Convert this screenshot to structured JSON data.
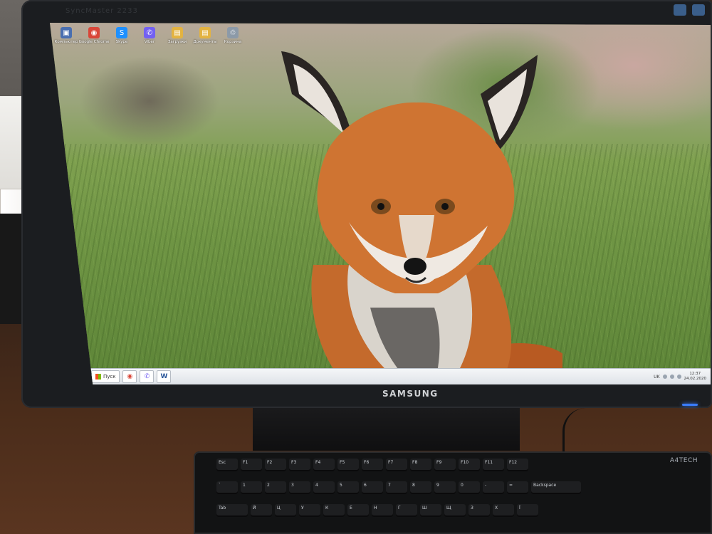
{
  "monitor": {
    "brand": "SAMSUNG",
    "top_brand": "SyncMaster 2233"
  },
  "desktop": {
    "icons": [
      {
        "label": "Компьютер",
        "icon": "computer-icon",
        "color": "#4a6fb0"
      },
      {
        "label": "Google Chrome",
        "icon": "chrome-icon",
        "color": "#d94638"
      },
      {
        "label": "Skype",
        "icon": "skype-icon",
        "color": "#1e90ff"
      },
      {
        "label": "Viber",
        "icon": "viber-icon",
        "color": "#7360f2"
      },
      {
        "label": "Загрузки",
        "icon": "folder-icon",
        "color": "#e3b341"
      },
      {
        "label": "Документы",
        "icon": "folder-icon",
        "color": "#e3b341"
      },
      {
        "label": "Корзина",
        "icon": "recycle-bin-icon",
        "color": "#8c9aa8"
      }
    ]
  },
  "taskbar": {
    "start_label": "Пуск",
    "pinned": [
      {
        "icon": "chrome-icon",
        "glyph": "◉",
        "color": "#d94638"
      },
      {
        "icon": "viber-icon",
        "glyph": "✆",
        "color": "#7360f2"
      },
      {
        "icon": "word-icon",
        "glyph": "W",
        "color": "#2b579a"
      }
    ],
    "tray_lang": "UK",
    "clock_time": "12:37",
    "clock_date": "24.02.2020"
  },
  "keyboard": {
    "brand": "A4TECH",
    "row1": [
      "Esc",
      "F1",
      "F2",
      "F3",
      "F4",
      "F5",
      "F6",
      "F7",
      "F8",
      "F9",
      "F10",
      "F11",
      "F12"
    ],
    "row2": [
      "`",
      "1",
      "2",
      "3",
      "4",
      "5",
      "6",
      "7",
      "8",
      "9",
      "0",
      "-",
      "=",
      "Backspace"
    ],
    "row3": [
      "Tab",
      "Й",
      "Ц",
      "У",
      "К",
      "Е",
      "Н",
      "Г",
      "Ш",
      "Щ",
      "З",
      "Х",
      "Ї"
    ]
  },
  "colors": {
    "screen_bg": "#6d8a45",
    "fox_orange": "#c96a2b",
    "taskbar": "#e8ecf0"
  }
}
